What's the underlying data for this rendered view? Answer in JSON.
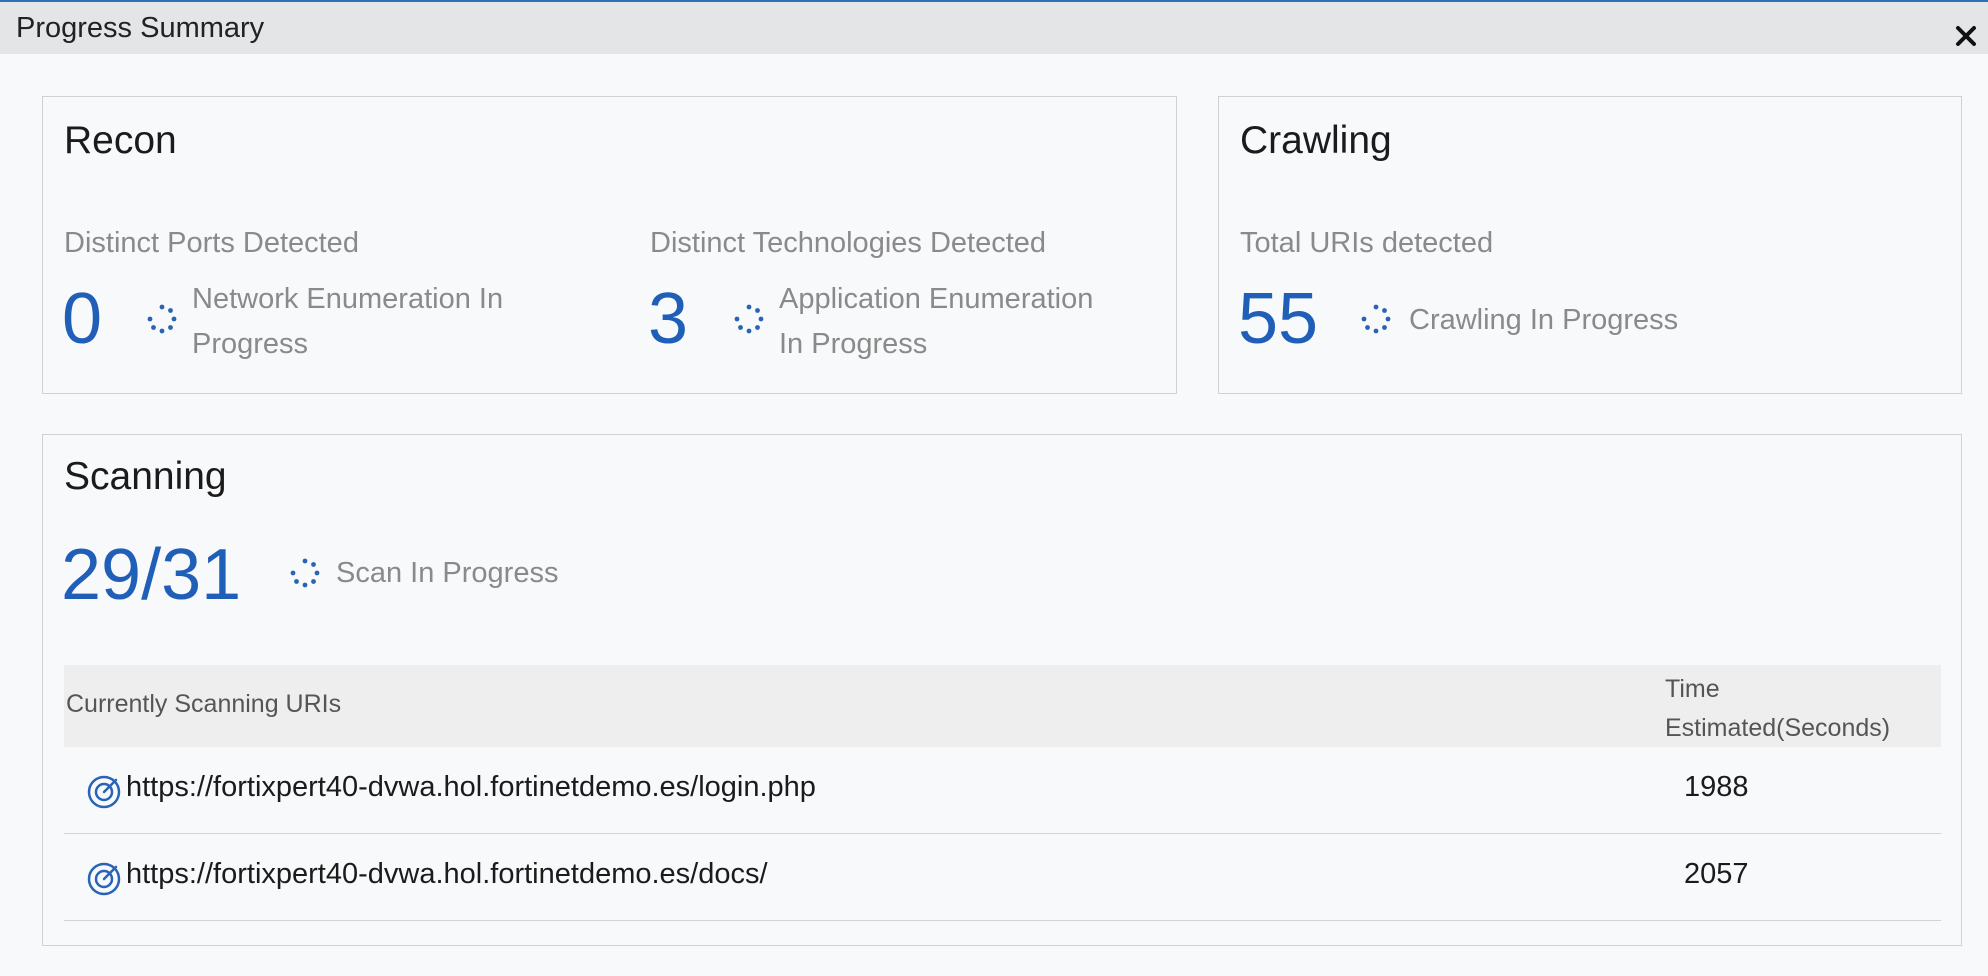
{
  "window": {
    "title": "Progress Summary"
  },
  "colors": {
    "accent": "#1f5fb8",
    "muted": "#8a8a8a",
    "titlebar": "#e4e5e6"
  },
  "icons": {
    "close": "close-icon",
    "spinner": "spinner-icon",
    "scan": "scan-target-icon"
  },
  "recon": {
    "title": "Recon",
    "ports": {
      "label": "Distinct Ports Detected",
      "value": "0",
      "status_line1": "Network Enumeration In",
      "status_line2": "Progress"
    },
    "technologies": {
      "label": "Distinct Technologies Detected",
      "value": "3",
      "status_line1": "Application Enumeration",
      "status_line2": "In Progress"
    }
  },
  "crawling": {
    "title": "Crawling",
    "label": "Total URIs detected",
    "value": "55",
    "status": "Crawling In Progress"
  },
  "scanning": {
    "title": "Scanning",
    "value": "29/31",
    "status": "Scan In Progress",
    "table": {
      "headers": {
        "uri": "Currently Scanning URIs",
        "time_line1": "Time",
        "time_line2": "Estimated(Seconds)"
      },
      "rows": [
        {
          "uri": "https://fortixpert40-dvwa.hol.fortinetdemo.es/login.php",
          "time": "1988"
        },
        {
          "uri": "https://fortixpert40-dvwa.hol.fortinetdemo.es/docs/",
          "time": "2057"
        }
      ]
    }
  }
}
